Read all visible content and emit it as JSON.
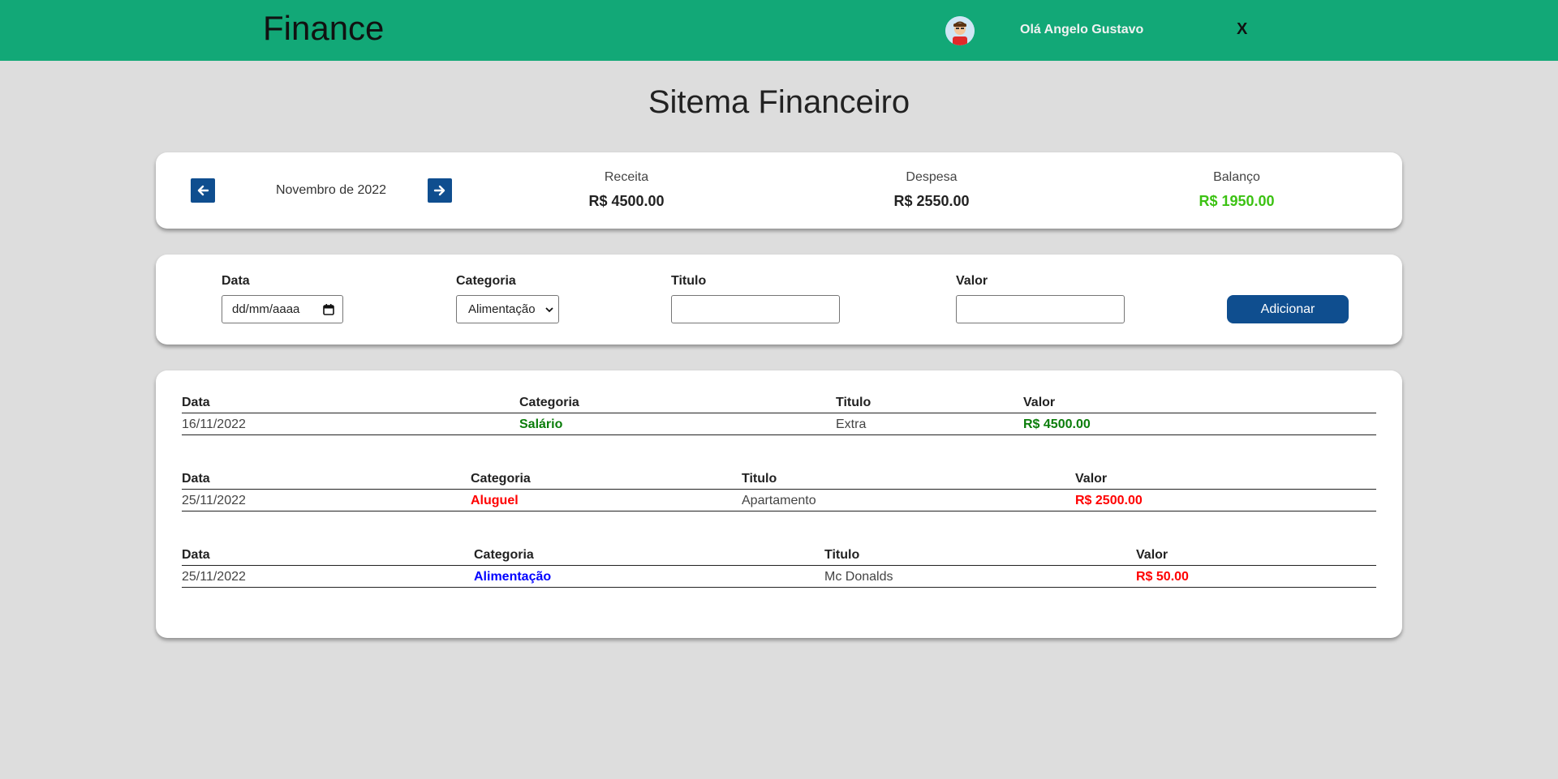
{
  "header": {
    "brand": "Finance",
    "greeting": "Olá Angelo Gustavo",
    "close_label": "X",
    "color": "#12a877"
  },
  "page_title": "Sitema Financeiro",
  "summary": {
    "month": "Novembro de 2022",
    "prev_icon": "arrow-left-icon",
    "next_icon": "arrow-right-icon",
    "receita_label": "Receita",
    "receita_value": "R$ 4500.00",
    "despesa_label": "Despesa",
    "despesa_value": "R$ 2550.00",
    "balanco_label": "Balanço",
    "balanco_value": "R$ 1950.00",
    "balanco_color": "#3cc213"
  },
  "form": {
    "data_label": "Data",
    "data_placeholder": "dd/mm/aaaa",
    "categoria_label": "Categoria",
    "categoria_selected": "Alimentação",
    "titulo_label": "Titulo",
    "titulo_value": "",
    "valor_label": "Valor",
    "valor_value": "",
    "add_label": "Adicionar"
  },
  "columns": [
    "Data",
    "Categoria",
    "Titulo",
    "Valor"
  ],
  "transactions": [
    {
      "data": "16/11/2022",
      "categoria": "Salário",
      "categoria_color": "#0a7d0a",
      "titulo": "Extra",
      "valor": "R$ 4500.00",
      "valor_color": "#0a7d0a"
    },
    {
      "data": "25/11/2022",
      "categoria": "Aluguel",
      "categoria_color": "#ff0000",
      "titulo": "Apartamento",
      "valor": "R$ 2500.00",
      "valor_color": "#ff0000"
    },
    {
      "data": "25/11/2022",
      "categoria": "Alimentação",
      "categoria_color": "#0000ff",
      "titulo": "Mc Donalds",
      "valor": "R$ 50.00",
      "valor_color": "#ff0000"
    }
  ]
}
